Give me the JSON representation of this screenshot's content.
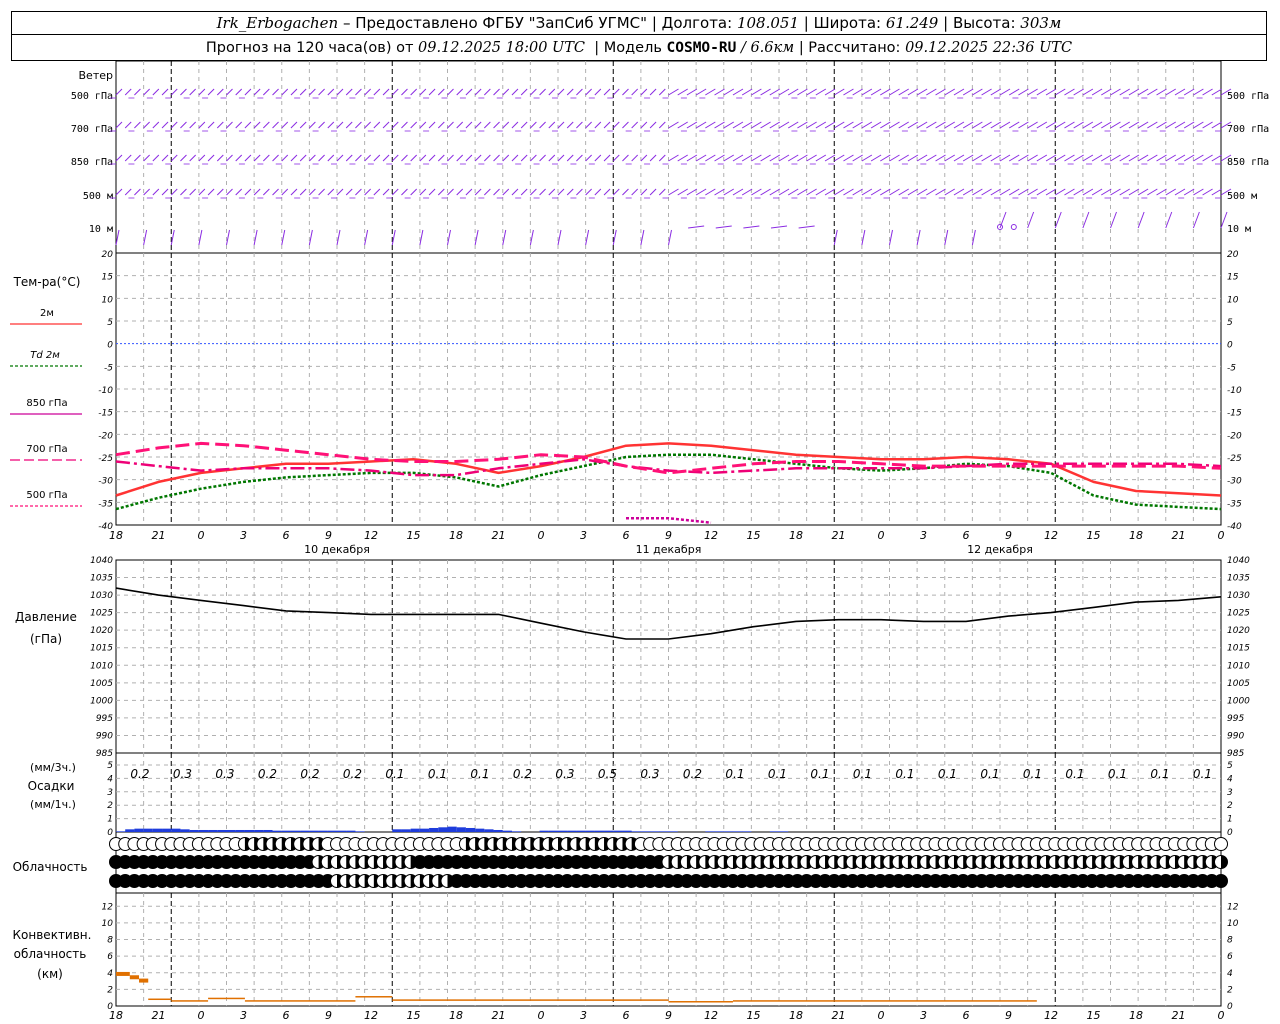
{
  "header": {
    "station": "Irk_Erbogachen",
    "provider": "– Предоставлено ФГБУ \"ЗапСиб УГМС\"",
    "lon_label": "| Долгота:",
    "lon_value": "108.051",
    "lat_label": "| Широта:",
    "lat_value": "61.249",
    "alt_label": "| Высота:",
    "alt_value": "303м",
    "forecast_label": "Прогноз на 120 часа(ов) от",
    "forecast_start": "09.12.2025 18:00 UTC",
    "model_label": "| Модель",
    "model_name": "COSMO-RU",
    "model_res": "/ 6.6км",
    "calc_label": "| Рассчитано:",
    "calc_time": "09.12.2025 22:36 UTC"
  },
  "labels": {
    "wind": "Ветер",
    "levels": [
      "500 гПа",
      "700 гПа",
      "850 гПа",
      "500 м",
      "10 м"
    ],
    "temp_title": "Тем-ра(°C)",
    "legend": [
      "2м",
      "Td 2м",
      "850 гПа",
      "700 гПа",
      "500 гПа"
    ],
    "pressure_title": [
      "Давление",
      "(гПа)"
    ],
    "precip_title": [
      "(мм/3ч.)",
      "Осадки",
      "(мм/1ч.)"
    ],
    "cloud_title": "Облачность",
    "conv_title": [
      "Конвективн.",
      "облачность",
      "(км)"
    ],
    "days": [
      "10 декабря",
      "11 декабря",
      "12 декабря"
    ]
  },
  "colors": {
    "t2m": "#ff3333",
    "td2m": "#007700",
    "t850": "#cc0099",
    "t700": "#ee0077",
    "t500": "#ff1177",
    "wind": "#8a2be2",
    "pressure": "#000000",
    "precip": "#1e3cdc",
    "conv": "#e07000",
    "zero_line": "#3355ff"
  },
  "chart_data": [
    {
      "type": "line",
      "panel": "temperature",
      "x_hours": [
        18,
        21,
        0,
        3,
        6,
        9,
        12,
        15,
        18,
        21,
        0,
        3,
        6,
        9,
        12,
        15,
        18,
        21,
        0,
        3,
        6,
        9,
        12,
        15,
        18,
        21,
        0
      ],
      "ylim": [
        -40,
        20
      ],
      "yticks": [
        20,
        15,
        10,
        5,
        0,
        -5,
        -10,
        -15,
        -20,
        -25,
        -30,
        -35,
        -40
      ],
      "series": [
        {
          "name": "2м",
          "values": [
            -33.5,
            -30.5,
            -28.5,
            -27.5,
            -26.5,
            -26.5,
            -26,
            -25.5,
            -26.5,
            -28.5,
            -27,
            -25,
            -22.5,
            -22,
            -22.5,
            -23.5,
            -24.5,
            -25,
            -25.5,
            -25.5,
            -25,
            -25.5,
            -26.5,
            -30.5,
            -32.5,
            -33,
            -33.5
          ]
        },
        {
          "name": "Td 2м",
          "values": [
            -36.5,
            -34,
            -32,
            -30.5,
            -29.5,
            -29,
            -28.5,
            -28.5,
            -29.5,
            -31.5,
            -29,
            -27,
            -25,
            -24.5,
            -24.5,
            -25.5,
            -26.5,
            -27.5,
            -28,
            -27.5,
            -26.5,
            -27,
            -28.5,
            -33.5,
            -35.5,
            -36,
            -36.5
          ]
        },
        {
          "name": "850 гПа",
          "values": [
            null,
            null,
            null,
            null,
            null,
            null,
            null,
            null,
            null,
            null,
            null,
            null,
            -38.5,
            -38.5,
            -39.5,
            null,
            null,
            null,
            null,
            null,
            null,
            null,
            null,
            null,
            null,
            null,
            null
          ]
        },
        {
          "name": "700 гПа",
          "values": [
            -26,
            -27,
            -28,
            -27.5,
            -27.5,
            -27.5,
            -28,
            -29,
            -29,
            -27.5,
            -26.5,
            -25.5,
            -27,
            -28,
            -28.5,
            -28,
            -27.5,
            -27.5,
            -27.5,
            -27.5,
            -27,
            -26.5,
            -26.5,
            -26.5,
            -26.5,
            -26.5,
            -27
          ]
        },
        {
          "name": "500 гПа",
          "values": [
            -24.5,
            -23,
            -22,
            -22.5,
            -23.5,
            -24.5,
            -25.5,
            -26,
            -26,
            -25.5,
            -24.5,
            -25,
            -27,
            -28.5,
            -27.5,
            -26.5,
            -26,
            -26,
            -26.5,
            -27,
            -27,
            -27,
            -27,
            -27,
            -27,
            -27,
            -27.5
          ]
        }
      ]
    },
    {
      "type": "line",
      "panel": "pressure",
      "ylim": [
        985,
        1040
      ],
      "yticks": [
        1040,
        1035,
        1030,
        1025,
        1020,
        1015,
        1010,
        1005,
        1000,
        995,
        990,
        985
      ],
      "values": [
        1032,
        1030,
        1028.5,
        1027,
        1025.5,
        1025,
        1024.5,
        1024.5,
        1024.5,
        1024.5,
        1022,
        1019.5,
        1017.5,
        1017.5,
        1019,
        1021,
        1022.5,
        1023,
        1023,
        1022.5,
        1022.5,
        1024,
        1025,
        1026.5,
        1028,
        1028.5,
        1029.5
      ]
    },
    {
      "type": "bar",
      "panel": "precipitation",
      "ylim": [
        0,
        5
      ],
      "yticks": [
        5,
        4,
        3,
        2,
        1,
        0
      ],
      "values_3h": [
        "0.2",
        "0.3",
        "0.3",
        "0.2",
        "0.2",
        "0.2",
        "0.1",
        "0.1",
        "0.1",
        "0.2",
        "0.3",
        "0.5",
        "0.3",
        "0.2",
        "0.1",
        "0.1",
        "0.1",
        "0.1",
        "0.1",
        "0.1",
        "0.1",
        "0.1",
        "0.1",
        "0.1",
        "0.1",
        "0.1"
      ],
      "hourly": [
        0.05,
        0.2,
        0.25,
        0.25,
        0.25,
        0.25,
        0.25,
        0.2,
        0.15,
        0.15,
        0.15,
        0.15,
        0.15,
        0.15,
        0.15,
        0.15,
        0.15,
        0.1,
        0.1,
        0.1,
        0.1,
        0.1,
        0.1,
        0.1,
        0.1,
        0.1,
        0.05,
        0,
        0,
        0,
        0.2,
        0.2,
        0.25,
        0.25,
        0.3,
        0.35,
        0.4,
        0.35,
        0.3,
        0.25,
        0.2,
        0.15,
        0.1,
        0.05,
        0,
        0,
        0.1,
        0.1,
        0.1,
        0.1,
        0.1,
        0.1,
        0.1,
        0.1,
        0.1,
        0.1,
        0.05,
        0.05,
        0.05,
        0.05,
        0.05,
        0,
        0,
        0,
        0.05,
        0.05,
        0.05,
        0.05,
        0.05,
        0,
        0,
        0.05,
        0.05,
        0,
        0,
        0,
        0,
        0,
        0,
        0,
        0,
        0,
        0,
        0,
        0,
        0,
        0,
        0,
        0,
        0,
        0,
        0,
        0,
        0,
        0,
        0,
        0,
        0,
        0,
        0,
        0,
        0,
        0,
        0,
        0,
        0,
        0,
        0,
        0,
        0,
        0,
        0,
        0,
        0,
        0,
        0,
        0,
        0,
        0,
        0
      ]
    },
    {
      "type": "bar",
      "panel": "convective_cloud",
      "ylim": [
        0,
        13
      ],
      "yticks": [
        12,
        10,
        8,
        6,
        4,
        2,
        0
      ],
      "segments": [
        {
          "h0": 0,
          "h1": 1.5,
          "top": 4.1
        },
        {
          "h0": 1.5,
          "h1": 2.5,
          "top": 3.7
        },
        {
          "h0": 2.5,
          "h1": 3.5,
          "top": 3.3
        },
        {
          "h0": 3.5,
          "h1": 6,
          "top": 0.9
        },
        {
          "h0": 6,
          "h1": 10,
          "top": 0.7
        },
        {
          "h0": 10,
          "h1": 14,
          "top": 1
        },
        {
          "h0": 14,
          "h1": 26,
          "top": 0.7
        },
        {
          "h0": 26,
          "h1": 30,
          "top": 1.2
        },
        {
          "h0": 30,
          "h1": 60,
          "top": 0.8
        },
        {
          "h0": 60,
          "h1": 67,
          "top": 0.6
        },
        {
          "h0": 67,
          "h1": 100,
          "top": 0.7
        }
      ]
    }
  ]
}
